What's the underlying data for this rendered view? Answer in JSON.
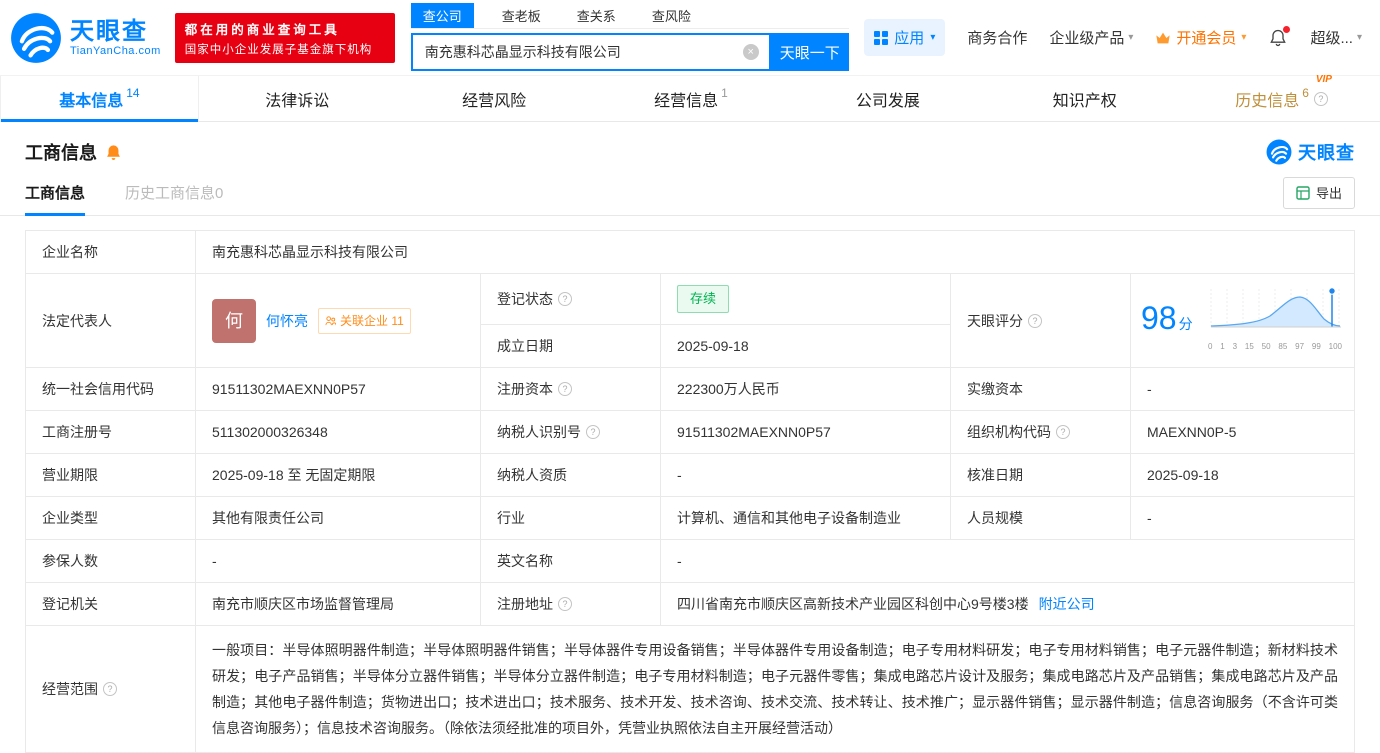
{
  "header": {
    "logo": {
      "title": "天眼查",
      "subtitle": "TianYanCha.com"
    },
    "promo": {
      "line1": "都在用的商业查询工具",
      "line2": "国家中小企业发展子基金旗下机构"
    },
    "search": {
      "tabs": [
        {
          "label": "查公司"
        },
        {
          "label": "查老板"
        },
        {
          "label": "查关系"
        },
        {
          "label": "查风险"
        }
      ],
      "value": "南充惠科芯晶显示科技有限公司",
      "button": "天眼一下"
    },
    "right": {
      "apps": "应用",
      "cooperation": "商务合作",
      "enterprise": "企业级产品",
      "vip": "开通会员",
      "super": "超级..."
    }
  },
  "nav_tabs": [
    {
      "label": "基本信息",
      "count": "14"
    },
    {
      "label": "法律诉讼",
      "count": ""
    },
    {
      "label": "经营风险",
      "count": ""
    },
    {
      "label": "经营信息",
      "count": "1"
    },
    {
      "label": "公司发展",
      "count": ""
    },
    {
      "label": "知识产权",
      "count": ""
    },
    {
      "label": "历史信息",
      "count": "6",
      "badge": "VIP"
    }
  ],
  "section": {
    "title": "工商信息",
    "brand": "天眼查"
  },
  "subtabs": {
    "current": "工商信息",
    "history": "历史工商信息0",
    "export": "导出"
  },
  "info": {
    "company_name": {
      "label": "企业名称",
      "value": "南充惠科芯晶显示科技有限公司"
    },
    "legal_rep": {
      "label": "法定代表人",
      "avatar": "何",
      "name": "何怀亮",
      "related": "关联企业 11"
    },
    "reg_status": {
      "label": "登记状态",
      "value": "存续"
    },
    "establish_date": {
      "label": "成立日期",
      "value": "2025-09-18"
    },
    "score": {
      "label": "天眼评分",
      "value": "98",
      "unit": "分",
      "axis_ticks": [
        "0",
        "1",
        "3",
        "15",
        "50",
        "85",
        "97",
        "99",
        "100"
      ]
    },
    "credit_code": {
      "label": "统一社会信用代码",
      "value": "91511302MAEXNN0P57"
    },
    "reg_capital": {
      "label": "注册资本",
      "value": "222300万人民币"
    },
    "paid_capital": {
      "label": "实缴资本",
      "value": "-"
    },
    "reg_number": {
      "label": "工商注册号",
      "value": "511302000326348"
    },
    "taxpayer_id": {
      "label": "纳税人识别号",
      "value": "91511302MAEXNN0P57"
    },
    "org_code": {
      "label": "组织机构代码",
      "value": "MAEXNN0P-5"
    },
    "business_term": {
      "label": "营业期限",
      "value": "2025-09-18 至 无固定期限"
    },
    "taxpayer_quality": {
      "label": "纳税人资质",
      "value": "-"
    },
    "approval_date": {
      "label": "核准日期",
      "value": "2025-09-18"
    },
    "company_type": {
      "label": "企业类型",
      "value": "其他有限责任公司"
    },
    "industry": {
      "label": "行业",
      "value": "计算机、通信和其他电子设备制造业"
    },
    "staff_size": {
      "label": "人员规模",
      "value": "-"
    },
    "insured_count": {
      "label": "参保人数",
      "value": "-"
    },
    "english_name": {
      "label": "英文名称",
      "value": "-"
    },
    "reg_authority": {
      "label": "登记机关",
      "value": "南充市顺庆区市场监督管理局"
    },
    "reg_address": {
      "label": "注册地址",
      "value": "四川省南充市顺庆区高新技术产业园区科创中心9号楼3楼",
      "link": "附近公司"
    },
    "business_scope": {
      "label": "经营范围",
      "value": "一般项目：半导体照明器件制造；半导体照明器件销售；半导体器件专用设备销售；半导体器件专用设备制造；电子专用材料研发；电子专用材料销售；电子元器件制造；新材料技术研发；电子产品销售；半导体分立器件销售；半导体分立器件制造；电子专用材料制造；电子元器件零售；集成电路芯片设计及服务；集成电路芯片及产品销售；集成电路芯片及产品制造；其他电子器件制造；货物进出口；技术进出口；技术服务、技术开发、技术咨询、技术交流、技术转让、技术推广；显示器件销售；显示器件制造；信息咨询服务（不含许可类信息咨询服务）；信息技术咨询服务。（除依法须经批准的项目外，凭营业执照依法自主开展经营活动）"
    }
  }
}
